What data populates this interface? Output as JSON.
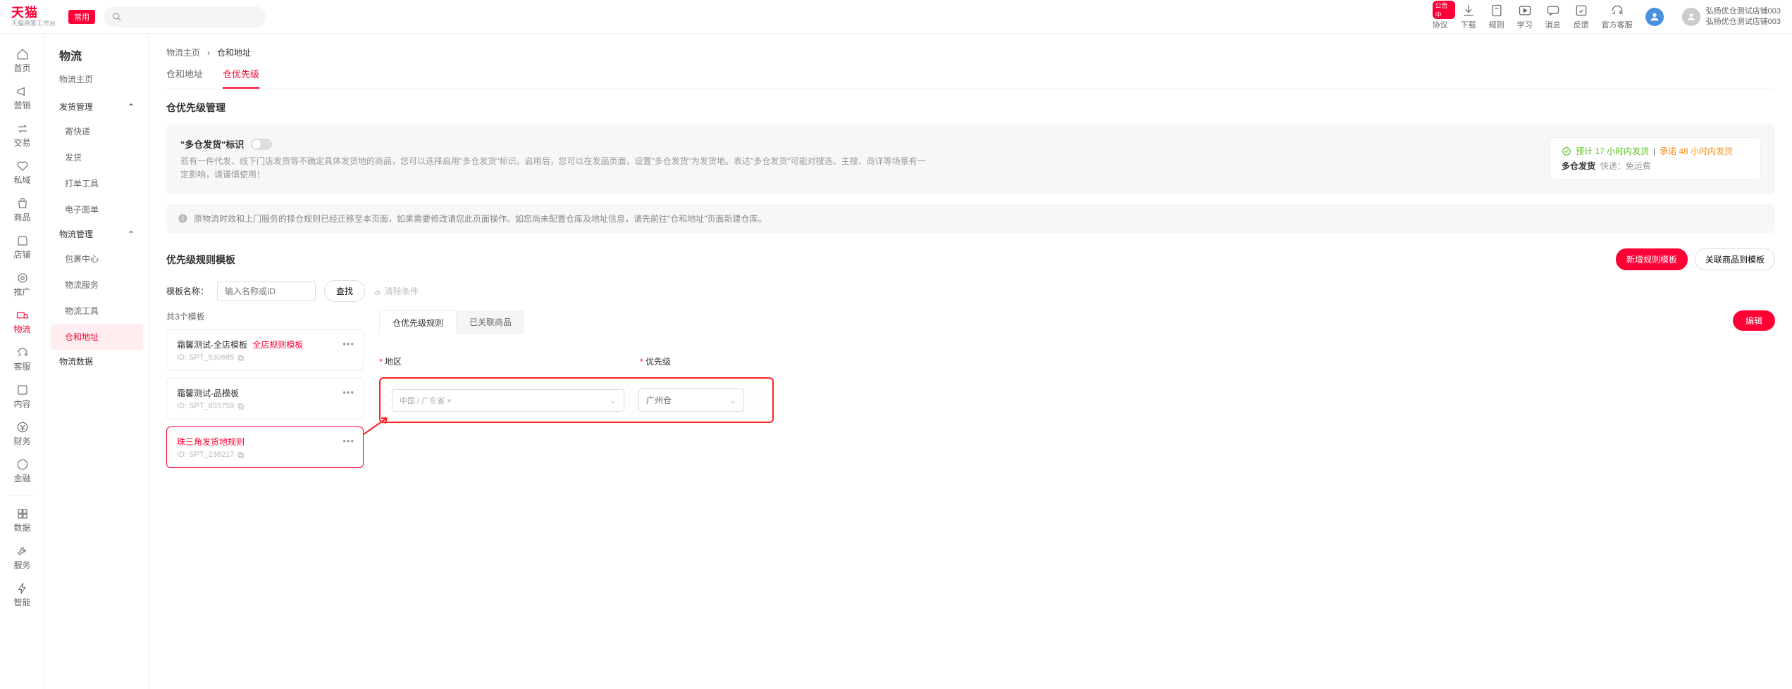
{
  "topbar": {
    "logo": "天猫",
    "logo_sub": "天猫商家工作台",
    "common_tag": "常用",
    "icons": [
      {
        "label": "协议",
        "badge": "公告中"
      },
      {
        "label": "下载"
      },
      {
        "label": "规则"
      },
      {
        "label": "学习"
      },
      {
        "label": "消息"
      },
      {
        "label": "反馈"
      },
      {
        "label": "官方客服"
      }
    ],
    "user_name1": "弘扬优仓测试店铺003",
    "user_name2": "弘扬优仓测试店铺003"
  },
  "sidebar": {
    "items": [
      "首页",
      "营销",
      "交易",
      "私域",
      "商品",
      "店铺",
      "推广",
      "物流",
      "客服",
      "内容",
      "财务",
      "金融"
    ],
    "items2": [
      "数据",
      "服务",
      "智能"
    ],
    "active": "物流"
  },
  "subsidebar": {
    "title": "物流",
    "home": "物流主页",
    "group1": "发货管理",
    "g1_items": [
      "寄快递",
      "发货",
      "打单工具",
      "电子面单"
    ],
    "group2": "物流管理",
    "g2_items": [
      "包裹中心",
      "物流服务",
      "物流工具",
      "仓和地址"
    ],
    "group3": "物流数据",
    "active": "仓和地址"
  },
  "breadcrumb": {
    "a": "物流主页",
    "b": "仓和地址"
  },
  "tabs": {
    "a": "仓和地址",
    "b": "仓优先级",
    "active": "仓优先级"
  },
  "section": {
    "title": "仓优先级管理",
    "card_title": "\"多仓发货\"标识",
    "card_desc": "若有一件代发、线下门店发货等不确定具体发货地的商品，您可以选择启用\"多仓发货\"标识。启用后，您可以在发品页面，设置\"多仓发货\"为发货地。表达\"多仓发货\"可能对搜选、主搜、商详等场景有一定影响，请谨慎使用！",
    "card_r1a": "预计 17 小时内发货",
    "card_r1b": "承诺 48 小时内发货",
    "card_r2a": "多仓发货",
    "card_r2b": "快递：免运费",
    "alert": "原物流时效和上门服务的择仓规则已经迁移至本页面，如果需要修改请您此页面操作。如您尚未配置仓库及地址信息，请先前往\"仓和地址\"页面新建仓库。"
  },
  "rules": {
    "title": "优先级规则模板",
    "btn_new": "新增规则模板",
    "btn_link": "关联商品到模板",
    "filter_label": "模板名称：",
    "filter_ph": "输入名称或ID",
    "btn_find": "查找",
    "clear": "清除条件",
    "count": "共3个模板",
    "templates": [
      {
        "name": "霜馨测试-全店模板",
        "tag": "全店规则模板",
        "id": "ID: SPT_530685"
      },
      {
        "name": "霜馨测试-品模板",
        "id": "ID: SPT_855759"
      },
      {
        "name": "珠三角发货地规则",
        "id": "ID: SPT_236217"
      }
    ],
    "active_idx": 2,
    "sub_tabs": {
      "a": "仓优先级规则",
      "b": "已关联商品"
    },
    "btn_edit": "编辑",
    "field_region": "地区",
    "field_priority": "优先级",
    "region_val": "中国 / 广东省",
    "priority_val": "广州仓"
  }
}
